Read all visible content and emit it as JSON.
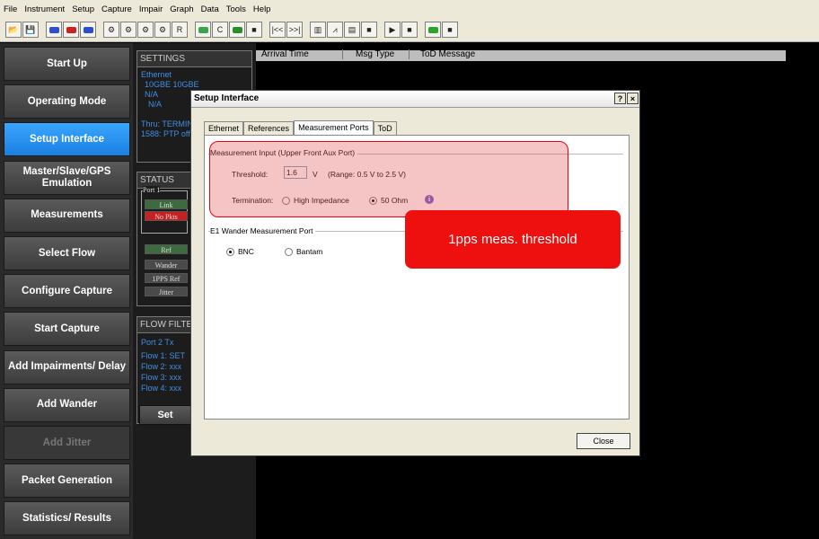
{
  "menu": [
    "File",
    "Instrument",
    "Setup",
    "Capture",
    "Impair",
    "Graph",
    "Data",
    "Tools",
    "Help"
  ],
  "toolbar": {
    "groups": [
      [
        {
          "icon": "open-folder-icon",
          "glyph": "📂"
        },
        {
          "icon": "save-icon",
          "glyph": "💾"
        }
      ],
      [
        {
          "icon": "port-blue-icon",
          "color": "#2c4fd1"
        },
        {
          "icon": "port-red-icon",
          "color": "#cc2222"
        },
        {
          "icon": "port-blue2-icon",
          "color": "#2c4fd1"
        }
      ],
      [
        {
          "icon": "pnf-icon",
          "glyph": "⚙"
        },
        {
          "icon": "pnf2-icon",
          "glyph": "⚙"
        },
        {
          "icon": "pnf3-icon",
          "glyph": "⚙"
        },
        {
          "icon": "pnf4-icon",
          "glyph": "⚙"
        },
        {
          "icon": "r-icon",
          "glyph": "R"
        }
      ],
      [
        {
          "icon": "wave-icon",
          "color": "#3aa54a"
        },
        {
          "icon": "c-icon",
          "glyph": "C"
        },
        {
          "icon": "dot-icon",
          "color": "#2a8f2a"
        },
        {
          "icon": "square-icon",
          "glyph": "■"
        }
      ],
      [
        {
          "icon": "rewind-icon",
          "glyph": "|<<"
        },
        {
          "icon": "forward-icon",
          "glyph": ">>|"
        }
      ],
      [
        {
          "icon": "grid-icon",
          "glyph": "▥"
        },
        {
          "icon": "graph-icon",
          "glyph": "⩘"
        },
        {
          "icon": "list-icon",
          "glyph": "▤"
        },
        {
          "icon": "stop-icon",
          "glyph": "■"
        }
      ],
      [
        {
          "icon": "play-icon",
          "glyph": "▶"
        },
        {
          "icon": "stop2-icon",
          "glyph": "■"
        }
      ],
      [
        {
          "icon": "record-icon",
          "color": "#2aa52a"
        },
        {
          "icon": "stop3-icon",
          "glyph": "■"
        }
      ]
    ]
  },
  "leftnav": [
    {
      "label": "Start Up",
      "state": "normal"
    },
    {
      "label": "Operating Mode",
      "state": "normal"
    },
    {
      "label": "Setup Interface",
      "state": "active"
    },
    {
      "label": "Master/Slave/GPS Emulation",
      "state": "normal"
    },
    {
      "label": "Measurements",
      "state": "normal"
    },
    {
      "label": "Select Flow",
      "state": "normal"
    },
    {
      "label": "Configure Capture",
      "state": "normal"
    },
    {
      "label": "Start Capture",
      "state": "normal"
    },
    {
      "label": "Add Impairments/ Delay",
      "state": "normal"
    },
    {
      "label": "Add Wander",
      "state": "normal"
    },
    {
      "label": "Add Jitter",
      "state": "disabled"
    },
    {
      "label": "Packet Generation",
      "state": "normal"
    },
    {
      "label": "Statistics/ Results",
      "state": "normal"
    }
  ],
  "settings": {
    "header": "SETTINGS",
    "lines": [
      "Ethernet",
      "10GBE  10GBE",
      "N/A",
      "N/A",
      "",
      "Thru: TERMIN",
      "1588: PTP off"
    ]
  },
  "status": {
    "header": "STATUS",
    "port_label": "Port 1",
    "link": "Link",
    "no_pkts": "No Pkts",
    "ref": "Ref",
    "wander": "Wander",
    "pps_ref": "1PPS Ref",
    "jitter": "Jitter"
  },
  "flow_filter": {
    "header": "FLOW FILTER",
    "lines": [
      "Port 2 Tx",
      "Flow 1: SET",
      "Flow 2: xxx",
      "Flow 3: xxx",
      "Flow 4: xxx"
    ],
    "set_label": "Set"
  },
  "arrival": {
    "columns": [
      "Arrival Time",
      "Msg Type",
      "ToD Message"
    ]
  },
  "dialog": {
    "title": "Setup Interface",
    "help": "?",
    "close_x": "×",
    "tabs": [
      "Ethernet",
      "References",
      "Measurement Ports",
      "ToD"
    ],
    "selected_tab": 2,
    "group1": "Measurement Input (Upper Front Aux Port)",
    "threshold_label": "Threshold:",
    "threshold_value": "1.6",
    "threshold_unit": "V",
    "threshold_range": "(Range: 0.5 V to 2.5 V)",
    "termination_label": "Termination:",
    "term_options": [
      "High Impedance",
      "50 Ohm"
    ],
    "term_selected": 1,
    "group2": "E1 Wander Measurement Port",
    "e1_options": [
      "BNC",
      "Bantam"
    ],
    "e1_selected": 0,
    "close_label": "Close"
  },
  "callout": "1pps meas. threshold",
  "colors": {
    "accent": "#1a7fe0",
    "highlight": "#e8000d"
  }
}
